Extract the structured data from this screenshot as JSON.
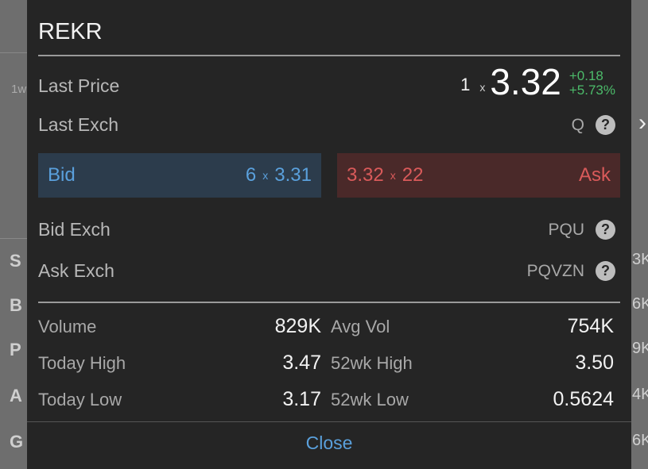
{
  "modal": {
    "symbol": "REKR",
    "last_price": {
      "label": "Last Price",
      "size": "1",
      "x": "x",
      "price": "3.32",
      "change": "+0.18",
      "change_pct": "+5.73%"
    },
    "last_exch": {
      "label": "Last Exch",
      "value": "Q"
    },
    "bid": {
      "label": "Bid",
      "size": "6",
      "x": "x",
      "price": "3.31"
    },
    "ask": {
      "label": "Ask",
      "size": "22",
      "x": "x",
      "price": "3.32"
    },
    "bid_exch": {
      "label": "Bid Exch",
      "value": "PQU"
    },
    "ask_exch": {
      "label": "Ask Exch",
      "value": "PQVZN"
    },
    "stats": {
      "volume": {
        "label": "Volume",
        "value": "829K"
      },
      "avg_vol": {
        "label": "Avg Vol",
        "value": "754K"
      },
      "today_high": {
        "label": "Today High",
        "value": "3.47"
      },
      "wk52_high": {
        "label": "52wk High",
        "value": "3.50"
      },
      "today_low": {
        "label": "Today Low",
        "value": "3.17"
      },
      "wk52_low": {
        "label": "52wk Low",
        "value": "0.5624"
      }
    },
    "help_icon": "?",
    "close_label": "Close"
  },
  "background": {
    "left_letters": [
      "S",
      "B",
      "P",
      "A",
      "G"
    ],
    "right_values": [
      "3K",
      "6K",
      "9K",
      "4K",
      "6K"
    ],
    "top_left": "1w",
    "chevron": "›"
  },
  "colors": {
    "positive": "#4cbb6a",
    "bid": "#5aa0dc",
    "ask": "#d95a5a",
    "modal_bg": "#252525"
  }
}
